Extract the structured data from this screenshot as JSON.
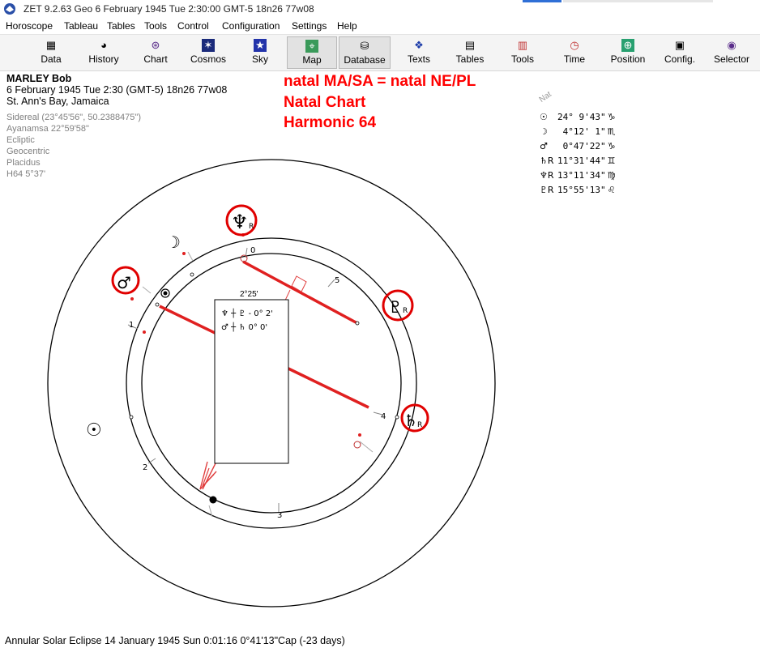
{
  "window": {
    "title": "ZET 9.2.63 Geo    6 February 1945  Tue   2:30:00 GMT-5 18n26  77w08"
  },
  "menu": [
    "Horoscope",
    "Tableau",
    "Tables",
    "Tools",
    "Control",
    "Configuration",
    "Settings",
    "Help"
  ],
  "toolbar": [
    {
      "label": "Data",
      "icon": "data-grid-icon"
    },
    {
      "label": "History",
      "icon": "history-icon"
    },
    {
      "label": "Chart",
      "icon": "chart-wheel-icon"
    },
    {
      "label": "Cosmos",
      "icon": "cosmos-icon"
    },
    {
      "label": "Sky",
      "icon": "sky-icon"
    },
    {
      "label": "Map",
      "icon": "map-icon"
    },
    {
      "label": "Database",
      "icon": "database-icon"
    },
    {
      "label": "Texts",
      "icon": "texts-icon"
    },
    {
      "label": "Tables",
      "icon": "tables-icon"
    },
    {
      "label": "Tools",
      "icon": "tools-icon"
    },
    {
      "label": "Time",
      "icon": "time-icon"
    },
    {
      "label": "Position",
      "icon": "position-icon"
    },
    {
      "label": "Config.",
      "icon": "config-icon"
    },
    {
      "label": "Selector",
      "icon": "selector-icon"
    }
  ],
  "chart_info": {
    "name": "MARLEY Bob",
    "datetime": "6 February 1945  Tue   2:30 (GMT-5) 18n26  77w08",
    "place": "St. Ann's Bay, Jamaica",
    "sidereal": "Sidereal (23°45'56\", 50.2388475\")",
    "ayanamsa": "Ayanamsa 22°59'58\"",
    "ecliptic": "Ecliptic",
    "geocentric": "Geocentric",
    "houses": "Placidus",
    "harmonic": "H64   5°37'"
  },
  "annotations": {
    "line1": "natal MA/SA = natal NE/PL",
    "line2": "Natal Chart",
    "line3": "Harmonic 64"
  },
  "legend": {
    "title": "Nat",
    "rows": [
      {
        "glyph": "☉",
        "value": "24° 9'43\"",
        "sign": "♑"
      },
      {
        "glyph": "☽",
        "value": " 4°12' 1\"",
        "sign": "♏"
      },
      {
        "glyph": "♂",
        "value": " 0°47'22\"",
        "sign": "♑"
      },
      {
        "glyph": "♄R",
        "value": "11°31'44\"",
        "sign": "♊"
      },
      {
        "glyph": "♆R",
        "value": "13°11'34\"",
        "sign": "♍"
      },
      {
        "glyph": "♇R",
        "value": "15°55'13\"",
        "sign": "♌"
      }
    ]
  },
  "midpoint_box": {
    "header": "2°25'",
    "row1": "♆ ┼ ♇ - 0° 2'",
    "row2": "♂ ┼ ♄   0° 0'"
  },
  "house_labels": [
    "0",
    "1",
    "2",
    "3",
    "4",
    "5"
  ],
  "planet_labels": {
    "neptune": "♆",
    "neptune_r": "R",
    "pluto": "♇",
    "pluto_r": "R",
    "saturn": "♄",
    "saturn_r": "R",
    "mars": "♂",
    "moon": "☽",
    "sun": "☉"
  },
  "status": "Annular Solar Eclipse 14 January 1945 Sun  0:01:16  0°41'13\"Cap (-23 days)",
  "colors": {
    "highlight": "#ff0000",
    "accent": "#2f6fd6"
  }
}
